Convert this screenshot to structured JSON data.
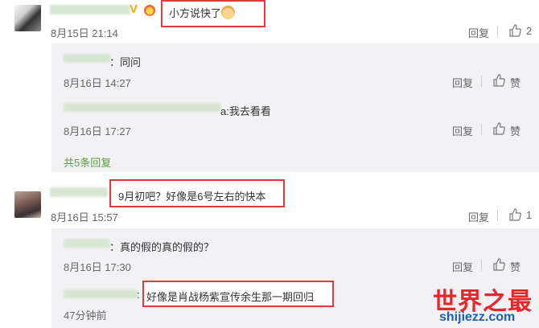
{
  "comments": [
    {
      "text": "小方说快了",
      "emoji": "doge-emoji",
      "time": "8月15日 21:14",
      "reply_label": "回复",
      "like_count": "2",
      "replies": [
        {
          "text": "：同问",
          "time": "8月16日 14:27",
          "reply_label": "回复",
          "like_label": "赞"
        },
        {
          "text": "a:我去看看",
          "time": "8月16日 17:27",
          "reply_label": "回复",
          "like_label": "赞"
        }
      ],
      "more_replies": "共5条回复"
    },
    {
      "text": "9月初吧？好像是6号左右的快本",
      "time": "8月16日 15:57",
      "reply_label": "回复",
      "like_count": "1",
      "replies": [
        {
          "text": "：真的假的真的假的？",
          "time": "8月16日 17:30",
          "reply_label": "回复",
          "like_label": "赞"
        },
        {
          "text": "好像是肖战杨紫宣传余生那一期回归",
          "time": "47分钟前"
        }
      ]
    }
  ],
  "watermark": {
    "title": "世界之最",
    "url": "shijiezz.com"
  },
  "colors": {
    "highlight_border": "#e23a3a",
    "link_green": "#5a9e3b",
    "watermark_red": "#e8262b",
    "watermark_blue": "#1d5fb3"
  }
}
